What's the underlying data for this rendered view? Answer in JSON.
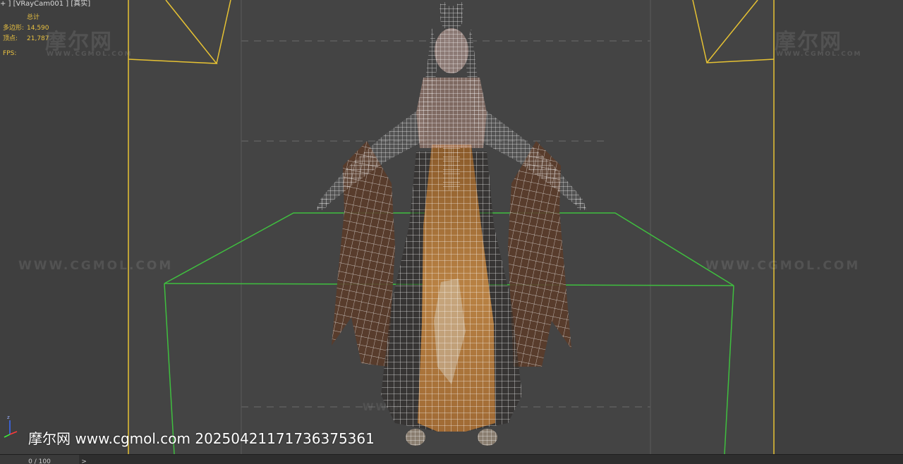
{
  "viewport": {
    "label": "+ ] [VRayCam001 ] [真实]",
    "stats": {
      "header": "总计",
      "polygons_label": "多边形:",
      "polygons_value": "14,590",
      "vertices_label": "顶点:",
      "vertices_value": "21,787",
      "fps_label": "FPS:"
    },
    "colors": {
      "background": "#444444",
      "camera_frame": "#e6c233",
      "bounding_box": "#3fbf3f",
      "wireframe": "#ffffff",
      "fabric": "#b07838"
    }
  },
  "watermark": {
    "logo_text": "摩尔网",
    "url_small": "WWW.CGMOL.COM",
    "url_large": "WWW.CGMOL.COM"
  },
  "caption": "摩尔网 www.cgmol.com 20250421171736375361",
  "timeline": {
    "frame_label": "0 / 100",
    "next_label": ">"
  }
}
